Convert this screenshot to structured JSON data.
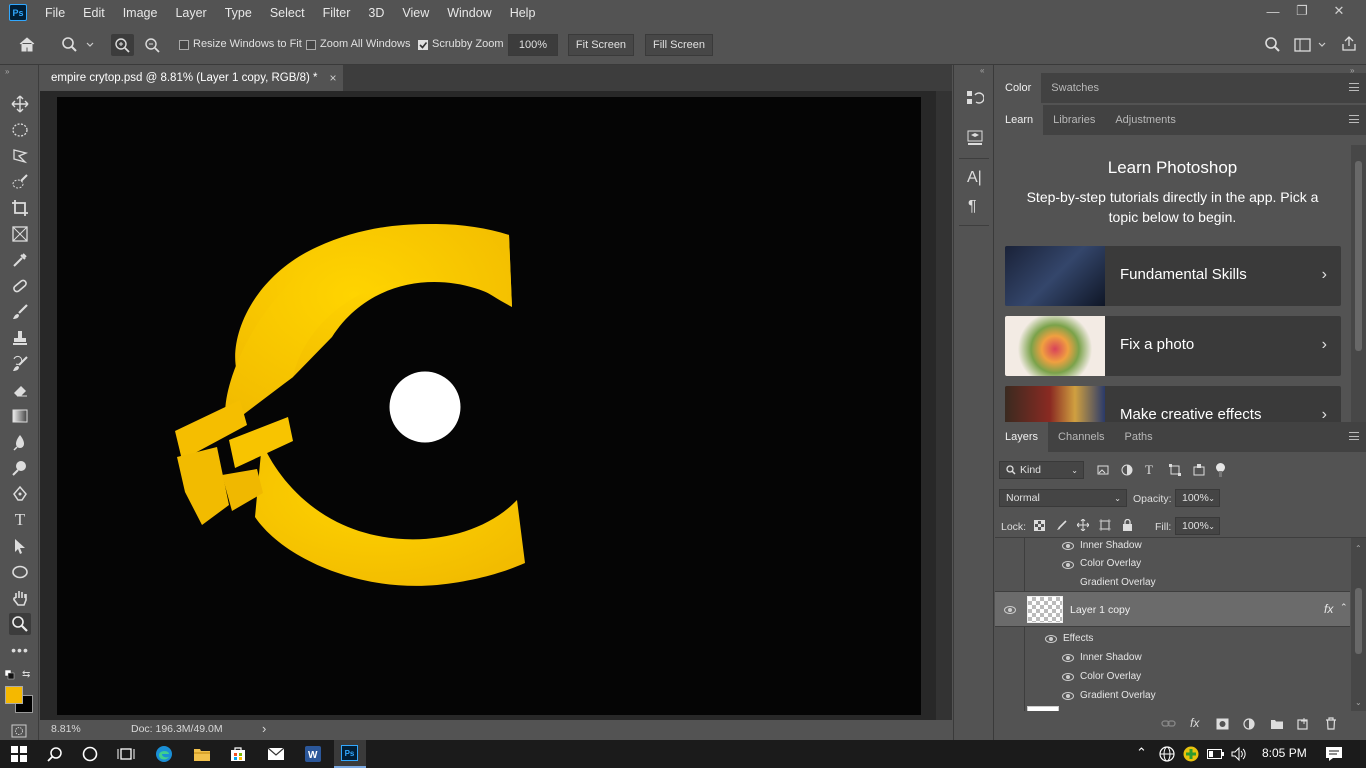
{
  "app": {
    "logo": "Ps"
  },
  "menu": [
    "File",
    "Edit",
    "Image",
    "Layer",
    "Type",
    "Select",
    "Filter",
    "3D",
    "View",
    "Window",
    "Help"
  ],
  "window_controls": {
    "minimize": "—",
    "restore": "❐",
    "close": "✕"
  },
  "options_bar": {
    "resize_windows": "Resize Windows to Fit",
    "zoom_all": "Zoom All Windows",
    "scrubby_zoom": "Scrubby Zoom",
    "zoom_value": "100%",
    "fit_screen": "Fit Screen",
    "fill_screen": "Fill Screen"
  },
  "document": {
    "tab_title": "empire crytop.psd @ 8.81% (Layer 1 copy, RGB/8) *",
    "close": "×",
    "zoom": "8.81%",
    "doc_size": "Doc: 196.3M/49.0M",
    "status_arrow": "›"
  },
  "colors": {
    "foreground": "#f5b800",
    "background": "#000000",
    "logo_yellow": "#fcc400"
  },
  "panels": {
    "color_tabs": [
      "Color",
      "Swatches"
    ],
    "learn_tabs": [
      "Learn",
      "Libraries",
      "Adjustments"
    ],
    "learn": {
      "title": "Learn Photoshop",
      "subtitle": "Step-by-step tutorials directly in the app. Pick a topic below to begin.",
      "cards": [
        "Fundamental Skills",
        "Fix a photo",
        "Make creative effects"
      ]
    },
    "layers_tabs": [
      "Layers",
      "Channels",
      "Paths"
    ],
    "filter_kind": "Kind",
    "blend_mode": "Normal",
    "opacity_label": "Opacity:",
    "opacity_value": "100%",
    "lock_label": "Lock:",
    "fill_label": "Fill:",
    "fill_value": "100%",
    "layers_top": [
      "Inner Shadow",
      "Color Overlay",
      "Gradient Overlay"
    ],
    "selected_layer": {
      "name": "Layer 1 copy",
      "fx": "fx"
    },
    "effects_label": "Effects",
    "effects": [
      "Inner Shadow",
      "Color Overlay",
      "Gradient Overlay"
    ]
  },
  "taskbar": {
    "time": "8:05 PM"
  }
}
